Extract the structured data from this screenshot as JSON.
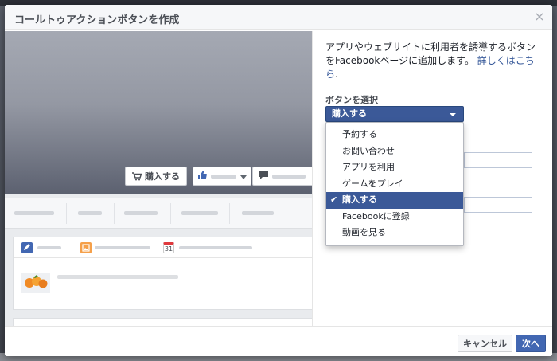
{
  "dialog": {
    "title": "コールトゥアクションボタンを作成",
    "close_label": "×"
  },
  "preview": {
    "cta_label": "購入する",
    "icons": [
      "shopping-cart-icon",
      "thumbs-up-icon",
      "speech-bubble-icon",
      "pencil-icon",
      "photo-icon",
      "calendar-icon"
    ],
    "calendar_day": "31"
  },
  "panel": {
    "description": "アプリやウェブサイトに利用者を誘導するボタンをFacebookページに追加します。",
    "details_link": "詳しくはこちら",
    "description_end": ".",
    "select_label": "ボタンを選択",
    "select_value": "購入する",
    "options": [
      {
        "label": "予約する",
        "selected": false
      },
      {
        "label": "お問い合わせ",
        "selected": false
      },
      {
        "label": "アプリを利用",
        "selected": false
      },
      {
        "label": "ゲームをプレイ",
        "selected": false
      },
      {
        "label": "購入する",
        "selected": true
      },
      {
        "label": "Facebookに登録",
        "selected": false
      },
      {
        "label": "動画を見る",
        "selected": false
      }
    ],
    "check_mark": "✔"
  },
  "footer": {
    "cancel_label": "キャンセル",
    "next_label": "次へ"
  },
  "colors": {
    "brand_blue": "#3b5998",
    "button_blue": "#4267b2",
    "link": "#365899"
  }
}
